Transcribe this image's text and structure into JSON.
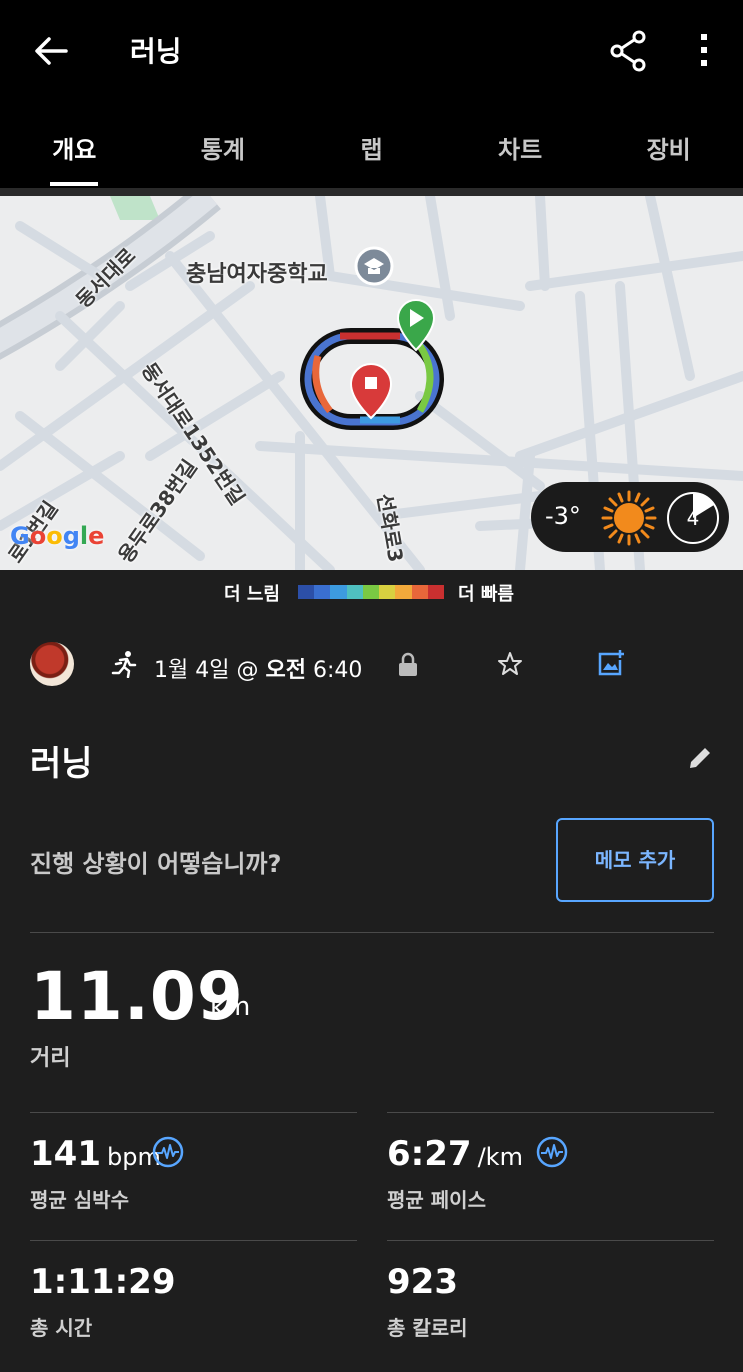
{
  "appbar": {
    "title": "러닝"
  },
  "tabs": [
    {
      "label": "개요",
      "active": true
    },
    {
      "label": "통계",
      "active": false
    },
    {
      "label": "랩",
      "active": false
    },
    {
      "label": "차트",
      "active": false
    },
    {
      "label": "장비",
      "active": false
    }
  ],
  "map": {
    "labels": {
      "school": "충남여자중학교",
      "road1": "동서대로",
      "road2": "동서대로1352번길",
      "road3": "용두로38번길",
      "road4": "선화로3",
      "road5": "로1번길"
    },
    "google": "Google",
    "weather": {
      "temp": "-3°",
      "moon_phase": "4"
    }
  },
  "legend": {
    "slow": "더 느림",
    "fast": "더 빠름",
    "colors": [
      "#2c4fa8",
      "#3a6fd0",
      "#3d9be0",
      "#4fc0c0",
      "#7ac943",
      "#d8d040",
      "#f2a93b",
      "#e8673a",
      "#c93030"
    ]
  },
  "info": {
    "date_prefix": "1월 4일 @ ",
    "ampm": "오전",
    "time": " 6:40"
  },
  "activity": {
    "title": "러닝",
    "prompt": "진행 상황이 어떻습니까?",
    "memo_button": "메모 추가"
  },
  "distance": {
    "value": "11.09",
    "unit": "km",
    "label": "거리"
  },
  "stats": {
    "hr": {
      "value": "141",
      "unit": "bpm",
      "label": "평균 심박수"
    },
    "pace": {
      "value": "6:27",
      "unit": "/km",
      "label": "평균 페이스"
    },
    "time": {
      "value": "1:11:29",
      "label": "총 시간"
    },
    "calories": {
      "value": "923",
      "label": "총 칼로리"
    }
  },
  "accent": "#58a6ff"
}
